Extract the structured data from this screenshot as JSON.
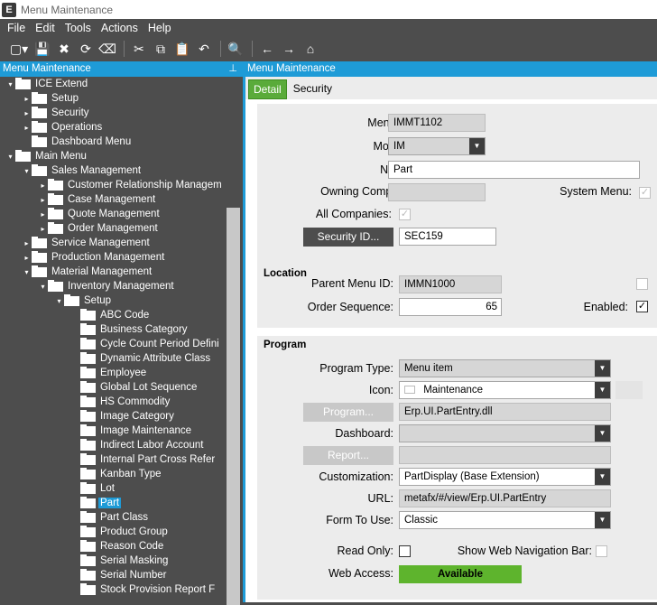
{
  "app": {
    "logo": "E",
    "title": "Menu Maintenance"
  },
  "menu": [
    "File",
    "Edit",
    "Tools",
    "Actions",
    "Help"
  ],
  "toolbar": {
    "icons": [
      "new-icon",
      "save-icon",
      "delete-icon",
      "refresh-icon",
      "clear-icon",
      "cut-icon",
      "copy-icon",
      "paste-icon",
      "undo-icon",
      "binoculars-icon",
      "back-icon",
      "forward-icon",
      "home-icon"
    ],
    "glyphs": [
      "▢▾",
      "💾",
      "✖",
      "⟳",
      "⌫",
      "✂",
      "⧉",
      "📋",
      "↶",
      "🔍",
      "←",
      "→",
      "⌂"
    ]
  },
  "tree": {
    "header": "Menu Maintenance",
    "pin": "⊥",
    "items": [
      {
        "label": "ICE Extend",
        "level": 0,
        "arrow": "▾"
      },
      {
        "label": "Setup",
        "level": 1,
        "arrow": "▸"
      },
      {
        "label": "Security",
        "level": 1,
        "arrow": "▸"
      },
      {
        "label": "Operations",
        "level": 1,
        "arrow": "▸"
      },
      {
        "label": "Dashboard Menu",
        "level": 1,
        "arrow": ""
      },
      {
        "label": "Main Menu",
        "level": 0,
        "arrow": "▾"
      },
      {
        "label": "Sales Management",
        "level": 1,
        "arrow": "▾"
      },
      {
        "label": "Customer Relationship Managem",
        "level": 2,
        "arrow": "▸"
      },
      {
        "label": "Case Management",
        "level": 2,
        "arrow": "▸"
      },
      {
        "label": "Quote Management",
        "level": 2,
        "arrow": "▸"
      },
      {
        "label": "Order Management",
        "level": 2,
        "arrow": "▸"
      },
      {
        "label": "Service Management",
        "level": 1,
        "arrow": "▸"
      },
      {
        "label": "Production Management",
        "level": 1,
        "arrow": "▸"
      },
      {
        "label": "Material Management",
        "level": 1,
        "arrow": "▾"
      },
      {
        "label": "Inventory Management",
        "level": 2,
        "arrow": "▾"
      },
      {
        "label": "Setup",
        "level": 3,
        "arrow": "▾"
      },
      {
        "label": "ABC Code",
        "level": 4,
        "arrow": ""
      },
      {
        "label": "Business Category",
        "level": 4,
        "arrow": ""
      },
      {
        "label": "Cycle Count Period Defini",
        "level": 4,
        "arrow": ""
      },
      {
        "label": "Dynamic Attribute Class",
        "level": 4,
        "arrow": ""
      },
      {
        "label": "Employee",
        "level": 4,
        "arrow": ""
      },
      {
        "label": "Global Lot Sequence",
        "level": 4,
        "arrow": ""
      },
      {
        "label": "HS Commodity",
        "level": 4,
        "arrow": ""
      },
      {
        "label": "Image Category",
        "level": 4,
        "arrow": ""
      },
      {
        "label": "Image Maintenance",
        "level": 4,
        "arrow": ""
      },
      {
        "label": "Indirect Labor Account",
        "level": 4,
        "arrow": ""
      },
      {
        "label": "Internal Part Cross Refer",
        "level": 4,
        "arrow": ""
      },
      {
        "label": "Kanban Type",
        "level": 4,
        "arrow": ""
      },
      {
        "label": "Lot",
        "level": 4,
        "arrow": ""
      },
      {
        "label": "Part",
        "level": 4,
        "arrow": "",
        "selected": true
      },
      {
        "label": "Part Class",
        "level": 4,
        "arrow": ""
      },
      {
        "label": "Product Group",
        "level": 4,
        "arrow": ""
      },
      {
        "label": "Reason Code",
        "level": 4,
        "arrow": ""
      },
      {
        "label": "Serial Masking",
        "level": 4,
        "arrow": ""
      },
      {
        "label": "Serial Number",
        "level": 4,
        "arrow": ""
      },
      {
        "label": "Stock Provision Report F",
        "level": 4,
        "arrow": ""
      }
    ]
  },
  "main": {
    "header": "Menu Maintenance",
    "tabs": [
      "Detail",
      "Security"
    ]
  },
  "form": {
    "menu_id": {
      "label": "Menu ID:",
      "value": "IMMT1102"
    },
    "module": {
      "label": "Module:",
      "value": "IM"
    },
    "name": {
      "label": "Name:",
      "value": "Part"
    },
    "owning_company": {
      "label": "Owning Company:",
      "value": ""
    },
    "system_menu": {
      "label": "System Menu:",
      "checked": true
    },
    "all_companies": {
      "label": "All Companies:",
      "checked": true
    },
    "security_id": {
      "button": "Security ID...",
      "value": "SEC159"
    },
    "location": {
      "title": "Location",
      "parent_menu_id": {
        "label": "Parent Menu ID:",
        "value": "IMMN1000"
      },
      "order_sequence": {
        "label": "Order Sequence:",
        "value": "65"
      },
      "enabled": {
        "label": "Enabled:",
        "checked": true
      }
    },
    "program": {
      "title": "Program",
      "program_type": {
        "label": "Program Type:",
        "value": "Menu item"
      },
      "icon": {
        "label": "Icon:",
        "value": "Maintenance"
      },
      "program": {
        "button": "Program...",
        "value": "Erp.UI.PartEntry.dll"
      },
      "dashboard": {
        "label": "Dashboard:",
        "value": ""
      },
      "report": {
        "button": "Report...",
        "value": ""
      },
      "customization": {
        "label": "Customization:",
        "value": "PartDisplay (Base Extension)"
      },
      "url": {
        "label": "URL:",
        "value": "metafx/#/view/Erp.UI.PartEntry"
      },
      "form_to_use": {
        "label": "Form To Use:",
        "value": "Classic"
      },
      "read_only": {
        "label": "Read Only:",
        "checked": false
      },
      "show_web_nav": {
        "label": "Show Web Navigation Bar:",
        "checked": false
      },
      "web_access": {
        "label": "Web Access:",
        "value": "Available"
      }
    }
  },
  "glyphs": {
    "check": "✓",
    "caret": "▼"
  },
  "colors": {
    "accent": "#1e9bd7",
    "active_tab": "#5aab3a",
    "available": "#5eb42d",
    "chrome": "#4d4d4d"
  }
}
